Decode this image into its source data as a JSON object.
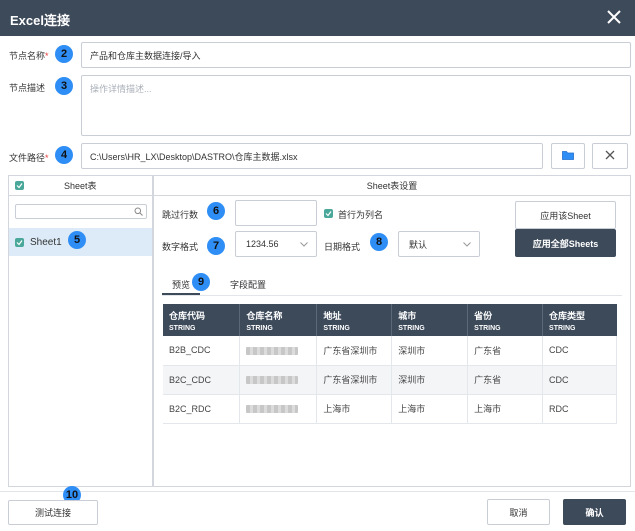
{
  "dialog": {
    "title": "Excel连接"
  },
  "form": {
    "node_name_label": "节点名称",
    "node_name_value": "产品和仓库主数据连接/导入",
    "node_desc_label": "节点描述",
    "node_desc_placeholder": "操作详情描述...",
    "file_path_label": "文件路径",
    "file_path_value": "C:\\Users\\HR_LX\\Desktop\\DASTRO\\仓库主数据.xlsx",
    "required_mark": "*"
  },
  "badges": [
    "2",
    "3",
    "4",
    "5",
    "6",
    "7",
    "8",
    "9",
    "10"
  ],
  "sheet_panel": {
    "title": "Sheet表",
    "items": [
      {
        "label": "Sheet1",
        "checked": true
      }
    ]
  },
  "settings": {
    "title": "Sheet表设置",
    "skip_rows_label": "跳过行数",
    "skip_rows_value": "",
    "first_row_header_label": "首行为列名",
    "number_format_label": "数字格式",
    "number_format_value": "1234.56",
    "date_format_label": "日期格式",
    "date_format_value": "默认",
    "apply_sheet_label": "应用该Sheet",
    "apply_all_label": "应用全部Sheets"
  },
  "tabs": [
    {
      "label": "预览",
      "active": true
    },
    {
      "label": "字段配置",
      "active": false
    }
  ],
  "table": {
    "columns": [
      {
        "name": "仓库代码",
        "type": "STRING"
      },
      {
        "name": "仓库名称",
        "type": "STRING"
      },
      {
        "name": "地址",
        "type": "STRING"
      },
      {
        "name": "城市",
        "type": "STRING"
      },
      {
        "name": "省份",
        "type": "STRING"
      },
      {
        "name": "仓库类型",
        "type": "STRING"
      }
    ],
    "rows": [
      [
        "B2B_CDC",
        "",
        "广东省深圳市",
        "深圳市",
        "广东省",
        "CDC"
      ],
      [
        "B2C_CDC",
        "",
        "广东省深圳市",
        "深圳市",
        "广东省",
        "CDC"
      ],
      [
        "B2C_RDC",
        "",
        "上海市",
        "上海市",
        "上海市",
        "RDC"
      ]
    ]
  },
  "footer": {
    "test_label": "测试连接",
    "cancel_label": "取消",
    "confirm_label": "确认"
  },
  "colors": {
    "header_bg": "#3d4a5a",
    "badge": "#2f8ef5",
    "check": "#4aa89a",
    "required": "#e53935"
  }
}
